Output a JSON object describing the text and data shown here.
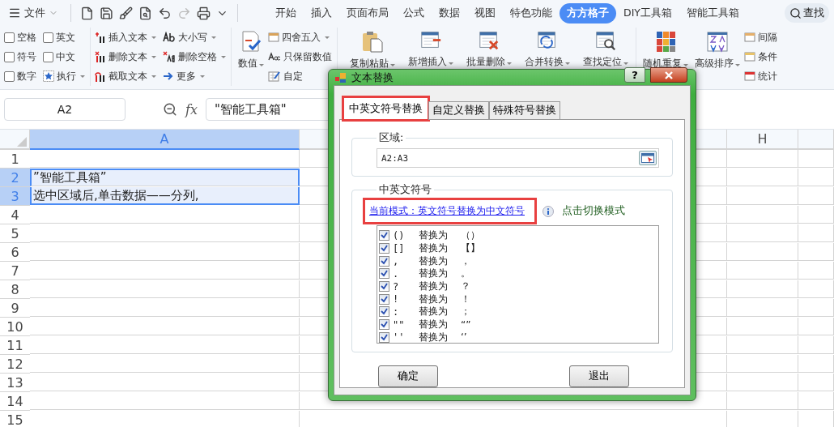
{
  "menu": {
    "file_label": "文件"
  },
  "tabs": [
    {
      "label": "开始",
      "selected": false
    },
    {
      "label": "插入",
      "selected": false
    },
    {
      "label": "页面布局",
      "selected": false
    },
    {
      "label": "公式",
      "selected": false
    },
    {
      "label": "数据",
      "selected": false
    },
    {
      "label": "视图",
      "selected": false
    },
    {
      "label": "特色功能",
      "selected": false
    },
    {
      "label": "方方格子",
      "selected": true
    },
    {
      "label": "DIY工具箱",
      "selected": false
    },
    {
      "label": "智能工具箱",
      "selected": false
    }
  ],
  "search": {
    "label": "查找"
  },
  "ribbon": [
    {
      "small": [
        {
          "kind": "checkbox",
          "label": "空格",
          "checked": false
        },
        {
          "kind": "checkbox",
          "label": "符号",
          "checked": false
        },
        {
          "kind": "checkbox",
          "label": "数字",
          "checked": false
        },
        {
          "kind": "checkbox",
          "label": "英文",
          "checked": false
        },
        {
          "kind": "checkbox",
          "label": "中文",
          "checked": false
        },
        {
          "kind": "command",
          "label": "执行",
          "dropdown": true
        }
      ]
    },
    {
      "small": [
        {
          "kind": "command",
          "label": "插入文本",
          "dropdown": true
        },
        {
          "kind": "command",
          "label": "删除文本",
          "dropdown": true
        },
        {
          "kind": "command",
          "label": "截取文本",
          "dropdown": true
        },
        {
          "kind": "command",
          "label": "大小写",
          "dropdown": true
        },
        {
          "kind": "command",
          "label": "删除空格",
          "dropdown": true
        },
        {
          "kind": "command",
          "label": "更多",
          "dropdown": true
        }
      ]
    },
    {
      "large": [
        {
          "label": "数值",
          "dropdown": true
        }
      ],
      "small": [
        {
          "kind": "command",
          "label": "四舍五入",
          "dropdown": true
        },
        {
          "kind": "command",
          "label": "只保留数值",
          "dropdown": false
        },
        {
          "kind": "command",
          "label": "自定",
          "dropdown": false
        }
      ]
    },
    {
      "large": [
        {
          "label": "复制粘贴",
          "dropdown": true
        },
        {
          "label": "新增插入",
          "dropdown": true
        },
        {
          "label": "批量删除",
          "dropdown": true
        },
        {
          "label": "合并转换",
          "dropdown": true
        },
        {
          "label": "查找定位",
          "dropdown": true
        }
      ]
    },
    {
      "large": [
        {
          "label": "随机重复",
          "dropdown": true
        },
        {
          "label": "高级排序",
          "dropdown": true
        }
      ],
      "small": [
        {
          "kind": "command",
          "label": "间隔",
          "dropdown": false
        },
        {
          "kind": "command",
          "label": "条件",
          "dropdown": false
        },
        {
          "kind": "command",
          "label": "统计",
          "dropdown": false
        }
      ]
    }
  ],
  "formula_bar": {
    "name_box": "A2",
    "fx": "fx",
    "formula": "\"智能工具箱\""
  },
  "sheet": {
    "columns": [
      {
        "label": "A",
        "selected": true
      },
      {
        "label": "H",
        "selected": false
      }
    ],
    "rows": [
      {
        "number": "1",
        "selected": false
      },
      {
        "number": "2",
        "selected": true,
        "cell": "”智能工具箱”"
      },
      {
        "number": "3",
        "selected": true,
        "cell": "选中区域后,单击数据——分列,"
      },
      {
        "number": "4",
        "selected": false
      },
      {
        "number": "5",
        "selected": false
      },
      {
        "number": "6",
        "selected": false
      },
      {
        "number": "7",
        "selected": false
      },
      {
        "number": "8",
        "selected": false
      },
      {
        "number": "9",
        "selected": false
      },
      {
        "number": "10",
        "selected": false
      },
      {
        "number": "11",
        "selected": false
      },
      {
        "number": "12",
        "selected": false
      },
      {
        "number": "13",
        "selected": false
      },
      {
        "number": "14",
        "selected": false
      },
      {
        "number": "15",
        "selected": false
      }
    ]
  },
  "dialog": {
    "title": "文本替换",
    "help": "?",
    "tabs": [
      {
        "label": "中英文符号替换",
        "selected": true,
        "highlighted": true
      },
      {
        "label": "自定义替换",
        "selected": false,
        "highlighted": false
      },
      {
        "label": "特殊符号替换",
        "selected": false,
        "highlighted": false
      }
    ],
    "range": {
      "legend": "区域:",
      "value": "A2:A3"
    },
    "symbols": {
      "legend": "中英文符号",
      "mode_link": "当前模式：英文符号替换为中文符号",
      "link_highlighted": true,
      "switch_hint": "点击切换模式",
      "rules": [
        {
          "from": "()",
          "verb": "替换为",
          "to": "（）",
          "checked": true
        },
        {
          "from": "[]",
          "verb": "替换为",
          "to": "【】",
          "checked": true
        },
        {
          "from": ",",
          "verb": "替换为",
          "to": "，",
          "checked": true
        },
        {
          "from": ".",
          "verb": "替换为",
          "to": "。",
          "checked": true
        },
        {
          "from": "?",
          "verb": "替换为",
          "to": "？",
          "checked": true
        },
        {
          "from": "!",
          "verb": "替换为",
          "to": "！",
          "checked": true
        },
        {
          "from": ":",
          "verb": "替换为",
          "to": "；",
          "checked": true
        },
        {
          "from": "\"\"",
          "verb": "替换为",
          "to": "“”",
          "checked": true
        },
        {
          "from": "''",
          "verb": "替换为",
          "to": "‘’",
          "checked": true
        }
      ]
    },
    "buttons": [
      "确定",
      "退出"
    ]
  }
}
